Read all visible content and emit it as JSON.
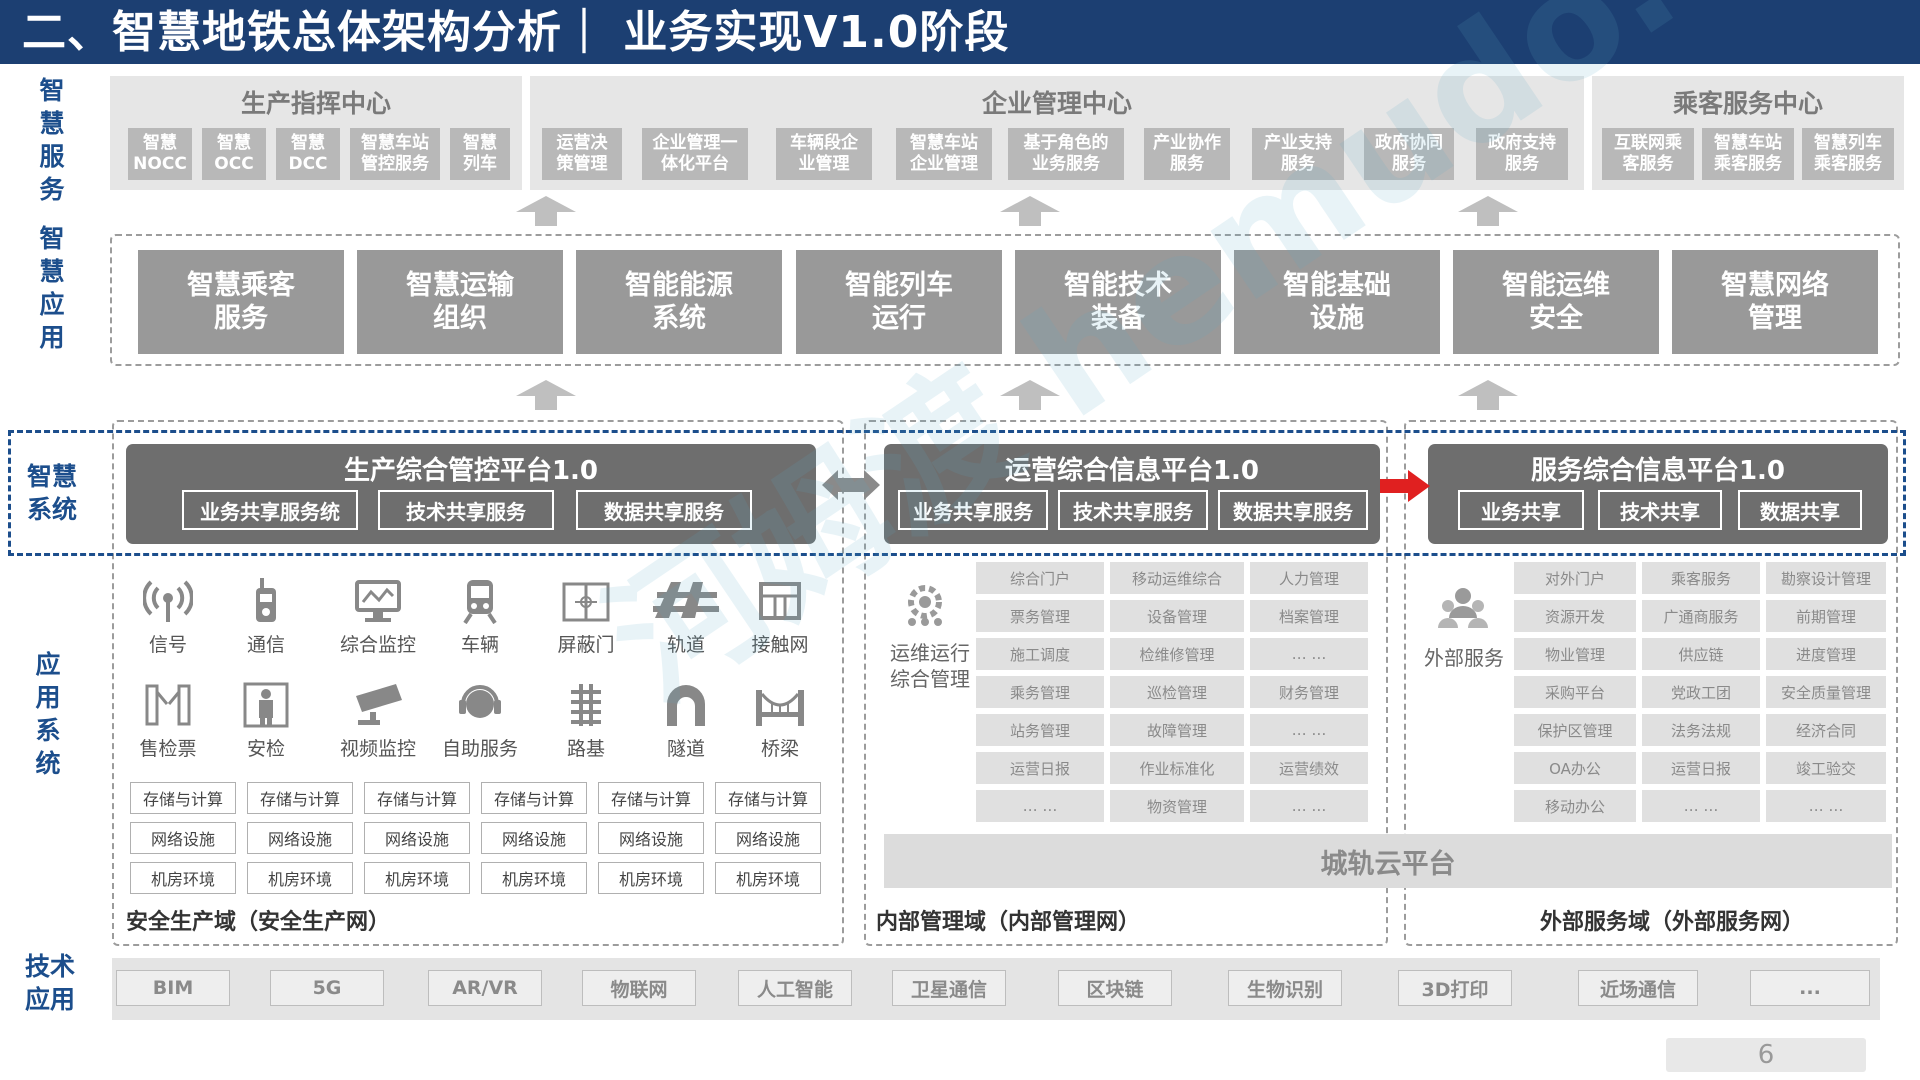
{
  "header": {
    "title": "二、智慧地铁总体架构分析｜ 业务实现V1.0阶段"
  },
  "watermark": {
    "text": "河姆渡 hemudo.com"
  },
  "layer_labels": {
    "smart_service": "智\n慧\n服\n务",
    "smart_application": "智\n慧\n应\n用",
    "smart_system": "智慧\n系统",
    "application_system": "应\n用\n系\n统",
    "technology_application": "技术\n应用"
  },
  "service_centers": [
    {
      "title": "生产指挥中心",
      "items": [
        "智慧\nNOCC",
        "智慧\nOCC",
        "智慧\nDCC",
        "智慧车站\n管控服务",
        "智慧\n列车"
      ]
    },
    {
      "title": "企业管理中心",
      "items": [
        "运营决\n策管理",
        "企业管理一\n体化平台",
        "车辆段企\n业管理",
        "智慧车站\n企业管理",
        "基于角色的\n业务服务",
        "产业协作\n服务",
        "产业支持\n服务",
        "政府协同\n服务",
        "政府支持\n服务"
      ]
    },
    {
      "title": "乘客服务中心",
      "items": [
        "互联网乘\n客服务",
        "智慧车站\n乘客服务",
        "智慧列车\n乘客服务"
      ]
    }
  ],
  "applications": [
    "智慧乘客\n服务",
    "智慧运输\n组织",
    "智能能源\n系统",
    "智能列车\n运行",
    "智能技术\n装备",
    "智能基础\n设施",
    "智能运维\n安全",
    "智慧网络\n管理"
  ],
  "platforms": [
    {
      "title": "生产综合管控平台1.0",
      "buttons": [
        "业务共享服务统",
        "技术共享服务",
        "数据共享服务"
      ]
    },
    {
      "title": "运营综合信息平台1.0",
      "buttons": [
        "业务共享服务",
        "技术共享服务",
        "数据共享服务"
      ]
    },
    {
      "title": "服务综合信息平台1.0",
      "buttons": [
        "业务共享",
        "技术共享",
        "数据共享"
      ]
    }
  ],
  "connector_colors": {
    "bidirectional": "#8a8a8a",
    "forward": "#e02020"
  },
  "production_icons": [
    {
      "label": "信号",
      "icon": "signal-icon"
    },
    {
      "label": "通信",
      "icon": "walkie-talkie-icon"
    },
    {
      "label": "综合监控",
      "icon": "monitor-icon"
    },
    {
      "label": "车辆",
      "icon": "train-icon"
    },
    {
      "label": "屏蔽门",
      "icon": "platform-door-icon"
    },
    {
      "label": "轨道",
      "icon": "track-icon"
    },
    {
      "label": "接触网",
      "icon": "catenary-icon"
    },
    {
      "label": "售检票",
      "icon": "ticket-gate-icon"
    },
    {
      "label": "安检",
      "icon": "security-check-icon"
    },
    {
      "label": "视频监控",
      "icon": "cctv-camera-icon"
    },
    {
      "label": "自助服务",
      "icon": "headset-icon"
    },
    {
      "label": "路基",
      "icon": "roadbed-icon"
    },
    {
      "label": "隧道",
      "icon": "tunnel-icon"
    },
    {
      "label": "桥梁",
      "icon": "bridge-icon"
    }
  ],
  "infrastructure": {
    "rows": [
      [
        "存储与计算",
        "存储与计算",
        "存储与计算",
        "存储与计算",
        "存储与计算",
        "存储与计算"
      ],
      [
        "网络设施",
        "网络设施",
        "网络设施",
        "网络设施",
        "网络设施",
        "网络设施"
      ],
      [
        "机房环境",
        "机房环境",
        "机房环境",
        "机房环境",
        "机房环境",
        "机房环境"
      ]
    ]
  },
  "internal": {
    "side_label": "运维运行\n综合管理",
    "side_icon": "gear-people-icon",
    "table": [
      [
        "综合门户",
        "移动运维综合",
        "人力管理"
      ],
      [
        "票务管理",
        "设备管理",
        "档案管理"
      ],
      [
        "施工调度",
        "检维修管理",
        "… …"
      ],
      [
        "乘务管理",
        "巡检管理",
        "财务管理"
      ],
      [
        "站务管理",
        "故障管理",
        "… …"
      ],
      [
        "运营日报",
        "作业标准化",
        "运营绩效"
      ],
      [
        "… …",
        "物资管理",
        "… …"
      ]
    ],
    "cloud_platform": "城轨云平台"
  },
  "external": {
    "side_label": "外部服务",
    "side_icon": "user-group-icon",
    "table": [
      [
        "对外门户",
        "乘客服务",
        "勘察设计管理"
      ],
      [
        "资源开发",
        "广通商服务",
        "前期管理"
      ],
      [
        "物业管理",
        "供应链",
        "进度管理"
      ],
      [
        "采购平台",
        "党政工团",
        "安全质量管理"
      ],
      [
        "保护区管理",
        "法务法规",
        "经济合同"
      ],
      [
        "OA办公",
        "运营日报",
        "竣工验交"
      ],
      [
        "移动办公",
        "… …",
        "… …"
      ]
    ]
  },
  "domains": {
    "production": "安全生产域（安全生产网）",
    "internal": "内部管理域（内部管理网）",
    "external": "外部服务域（外部服务网）"
  },
  "technologies": [
    "BIM",
    "5G",
    "AR/VR",
    "物联网",
    "人工智能",
    "卫星通信",
    "区块链",
    "生物识别",
    "3D打印",
    "近场通信",
    "..."
  ],
  "page_number": "6"
}
